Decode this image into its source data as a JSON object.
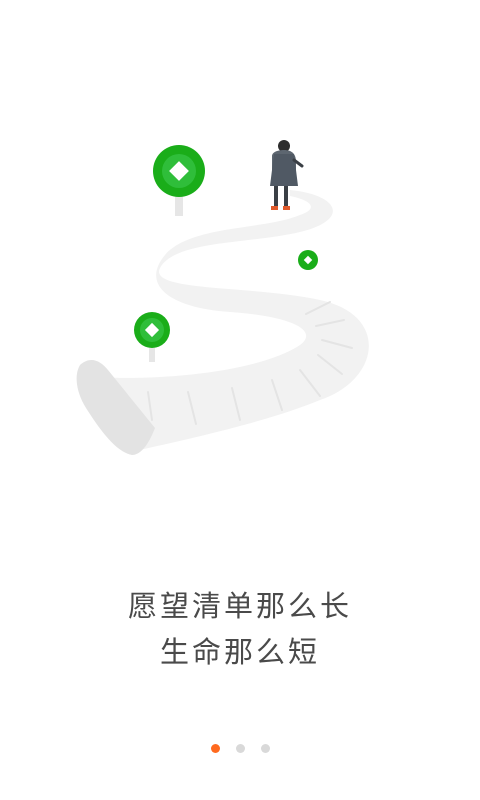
{
  "onboarding": {
    "line1": "愿望清单那么长",
    "line2": "生命那么短",
    "page_count": 3,
    "active_page": 1
  },
  "colors": {
    "accent": "#ff6a1f",
    "pin_green": "#1aad19",
    "text": "#4a4a4a",
    "dot_inactive": "#d9d9d9"
  },
  "icons": {
    "pin": "green-coin-pin-icon",
    "person": "walking-man-figure",
    "road": "winding-road-scroll"
  }
}
